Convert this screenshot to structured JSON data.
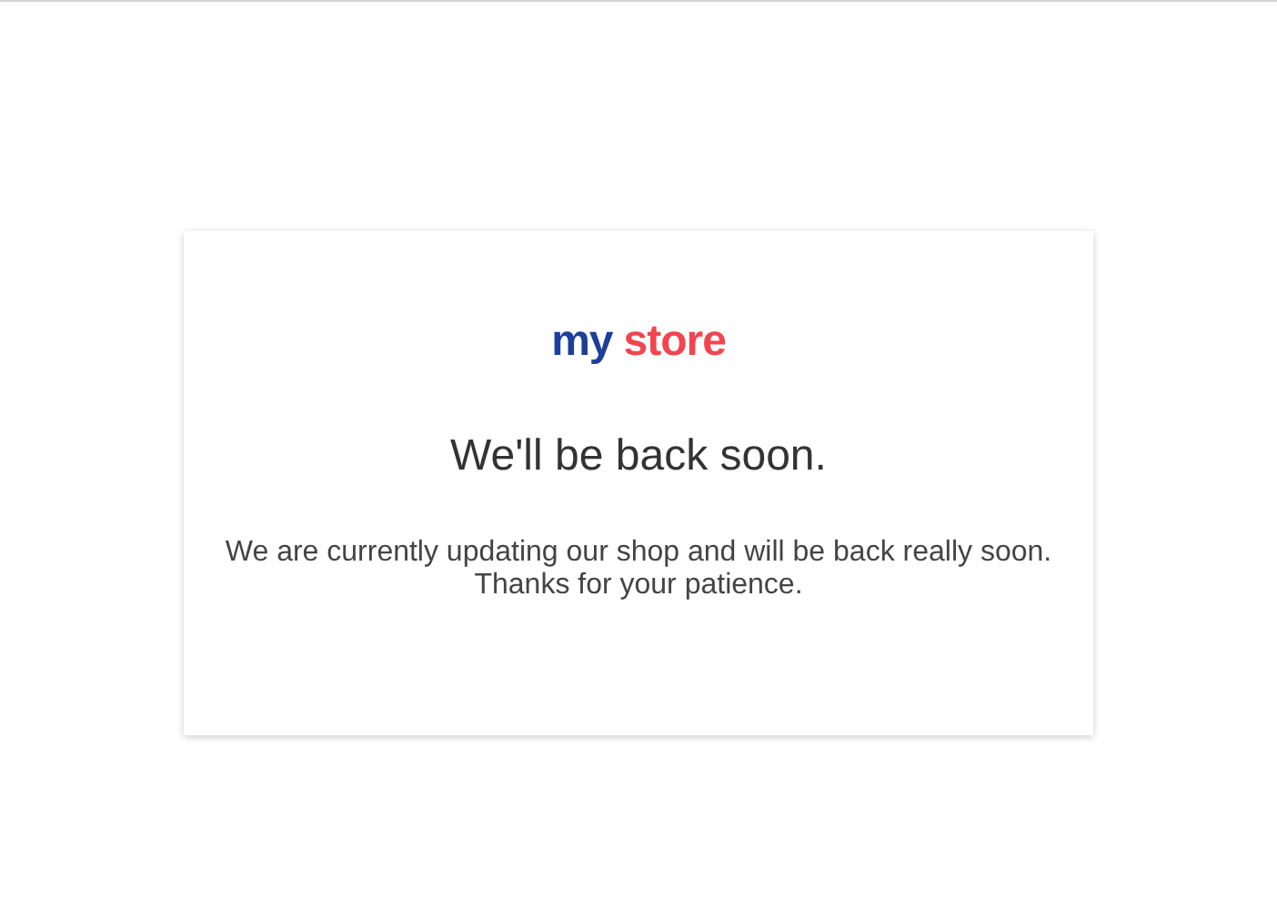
{
  "logo": {
    "parts": [
      {
        "text": "my",
        "color": "#1b3f9a"
      },
      {
        "text": "store",
        "color": "#f2454f"
      }
    ]
  },
  "heading": "We'll be back soon.",
  "message": "We are currently updating our shop and will be back really soon.",
  "thanks": "Thanks for your patience."
}
